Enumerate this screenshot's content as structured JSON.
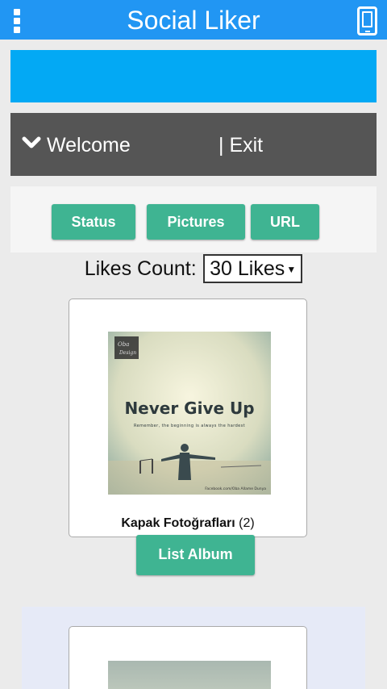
{
  "header": {
    "title": "Social Liker",
    "menu_icon": "menu-dots-icon",
    "device_icon": "phone-icon",
    "color": "#2196f3"
  },
  "banner": {
    "color": "#03a9f4"
  },
  "welcome": {
    "label": "Welcome",
    "exit_label": "| Exit",
    "icon": "chevron-down-icon"
  },
  "tabs": [
    {
      "label": "Status"
    },
    {
      "label": "Pictures"
    },
    {
      "label": "URL"
    }
  ],
  "likes": {
    "label": "Likes Count:",
    "selected": "30 Likes"
  },
  "album": {
    "name": "Kapak Fotoğrafları",
    "count": "(2)",
    "image": {
      "headline": "Never Give Up",
      "tagline": "Remember, the beginning is always the hardest",
      "footer": "Facebook.com/Oba Allame Dunya"
    },
    "button_label": "List Album"
  },
  "accent_color": "#3fb492"
}
